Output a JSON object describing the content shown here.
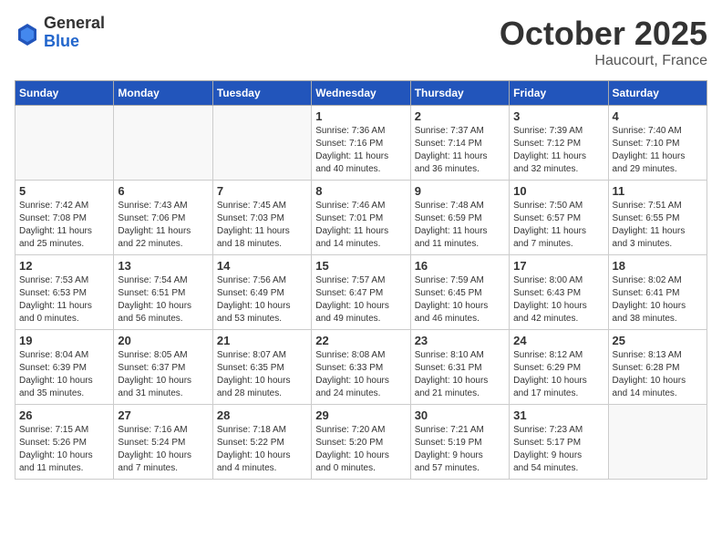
{
  "logo": {
    "general": "General",
    "blue": "Blue"
  },
  "title": "October 2025",
  "location": "Haucourt, France",
  "days_of_week": [
    "Sunday",
    "Monday",
    "Tuesday",
    "Wednesday",
    "Thursday",
    "Friday",
    "Saturday"
  ],
  "weeks": [
    [
      {
        "day": "",
        "info": ""
      },
      {
        "day": "",
        "info": ""
      },
      {
        "day": "",
        "info": ""
      },
      {
        "day": "1",
        "info": "Sunrise: 7:36 AM\nSunset: 7:16 PM\nDaylight: 11 hours\nand 40 minutes."
      },
      {
        "day": "2",
        "info": "Sunrise: 7:37 AM\nSunset: 7:14 PM\nDaylight: 11 hours\nand 36 minutes."
      },
      {
        "day": "3",
        "info": "Sunrise: 7:39 AM\nSunset: 7:12 PM\nDaylight: 11 hours\nand 32 minutes."
      },
      {
        "day": "4",
        "info": "Sunrise: 7:40 AM\nSunset: 7:10 PM\nDaylight: 11 hours\nand 29 minutes."
      }
    ],
    [
      {
        "day": "5",
        "info": "Sunrise: 7:42 AM\nSunset: 7:08 PM\nDaylight: 11 hours\nand 25 minutes."
      },
      {
        "day": "6",
        "info": "Sunrise: 7:43 AM\nSunset: 7:06 PM\nDaylight: 11 hours\nand 22 minutes."
      },
      {
        "day": "7",
        "info": "Sunrise: 7:45 AM\nSunset: 7:03 PM\nDaylight: 11 hours\nand 18 minutes."
      },
      {
        "day": "8",
        "info": "Sunrise: 7:46 AM\nSunset: 7:01 PM\nDaylight: 11 hours\nand 14 minutes."
      },
      {
        "day": "9",
        "info": "Sunrise: 7:48 AM\nSunset: 6:59 PM\nDaylight: 11 hours\nand 11 minutes."
      },
      {
        "day": "10",
        "info": "Sunrise: 7:50 AM\nSunset: 6:57 PM\nDaylight: 11 hours\nand 7 minutes."
      },
      {
        "day": "11",
        "info": "Sunrise: 7:51 AM\nSunset: 6:55 PM\nDaylight: 11 hours\nand 3 minutes."
      }
    ],
    [
      {
        "day": "12",
        "info": "Sunrise: 7:53 AM\nSunset: 6:53 PM\nDaylight: 11 hours\nand 0 minutes."
      },
      {
        "day": "13",
        "info": "Sunrise: 7:54 AM\nSunset: 6:51 PM\nDaylight: 10 hours\nand 56 minutes."
      },
      {
        "day": "14",
        "info": "Sunrise: 7:56 AM\nSunset: 6:49 PM\nDaylight: 10 hours\nand 53 minutes."
      },
      {
        "day": "15",
        "info": "Sunrise: 7:57 AM\nSunset: 6:47 PM\nDaylight: 10 hours\nand 49 minutes."
      },
      {
        "day": "16",
        "info": "Sunrise: 7:59 AM\nSunset: 6:45 PM\nDaylight: 10 hours\nand 46 minutes."
      },
      {
        "day": "17",
        "info": "Sunrise: 8:00 AM\nSunset: 6:43 PM\nDaylight: 10 hours\nand 42 minutes."
      },
      {
        "day": "18",
        "info": "Sunrise: 8:02 AM\nSunset: 6:41 PM\nDaylight: 10 hours\nand 38 minutes."
      }
    ],
    [
      {
        "day": "19",
        "info": "Sunrise: 8:04 AM\nSunset: 6:39 PM\nDaylight: 10 hours\nand 35 minutes."
      },
      {
        "day": "20",
        "info": "Sunrise: 8:05 AM\nSunset: 6:37 PM\nDaylight: 10 hours\nand 31 minutes."
      },
      {
        "day": "21",
        "info": "Sunrise: 8:07 AM\nSunset: 6:35 PM\nDaylight: 10 hours\nand 28 minutes."
      },
      {
        "day": "22",
        "info": "Sunrise: 8:08 AM\nSunset: 6:33 PM\nDaylight: 10 hours\nand 24 minutes."
      },
      {
        "day": "23",
        "info": "Sunrise: 8:10 AM\nSunset: 6:31 PM\nDaylight: 10 hours\nand 21 minutes."
      },
      {
        "day": "24",
        "info": "Sunrise: 8:12 AM\nSunset: 6:29 PM\nDaylight: 10 hours\nand 17 minutes."
      },
      {
        "day": "25",
        "info": "Sunrise: 8:13 AM\nSunset: 6:28 PM\nDaylight: 10 hours\nand 14 minutes."
      }
    ],
    [
      {
        "day": "26",
        "info": "Sunrise: 7:15 AM\nSunset: 5:26 PM\nDaylight: 10 hours\nand 11 minutes."
      },
      {
        "day": "27",
        "info": "Sunrise: 7:16 AM\nSunset: 5:24 PM\nDaylight: 10 hours\nand 7 minutes."
      },
      {
        "day": "28",
        "info": "Sunrise: 7:18 AM\nSunset: 5:22 PM\nDaylight: 10 hours\nand 4 minutes."
      },
      {
        "day": "29",
        "info": "Sunrise: 7:20 AM\nSunset: 5:20 PM\nDaylight: 10 hours\nand 0 minutes."
      },
      {
        "day": "30",
        "info": "Sunrise: 7:21 AM\nSunset: 5:19 PM\nDaylight: 9 hours\nand 57 minutes."
      },
      {
        "day": "31",
        "info": "Sunrise: 7:23 AM\nSunset: 5:17 PM\nDaylight: 9 hours\nand 54 minutes."
      },
      {
        "day": "",
        "info": ""
      }
    ]
  ]
}
